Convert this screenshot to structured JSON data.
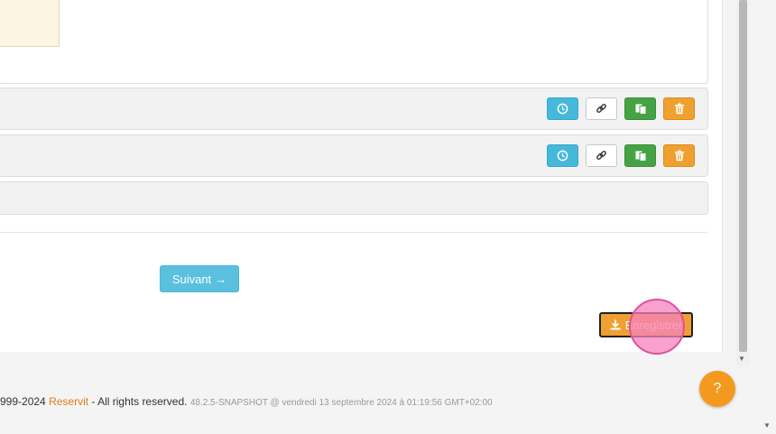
{
  "rows": [
    {
      "actions": [
        {
          "icon": "clock-icon"
        },
        {
          "icon": "link-icon"
        },
        {
          "icon": "copy-icon"
        },
        {
          "icon": "trash-icon"
        }
      ]
    },
    {
      "actions": [
        {
          "icon": "clock-icon"
        },
        {
          "icon": "link-icon"
        },
        {
          "icon": "copy-icon"
        },
        {
          "icon": "trash-icon"
        }
      ]
    }
  ],
  "navigation": {
    "next_label": "Suivant",
    "next_arrow": "→"
  },
  "form": {
    "save_label": "Enregistrer"
  },
  "footer": {
    "copyright_prefix": "999-2024",
    "brand": "Reservit",
    "rights": "- All rights reserved.",
    "version": "48.2.5-SNAPSHOT @ vendredi 13 septembre 2024 à 01:19:56 GMT+02:00"
  },
  "help": {
    "label": "?"
  },
  "colors": {
    "info": "#5bc0de",
    "success": "#45a345",
    "warning": "#f0a030",
    "brand": "#e07b1a"
  }
}
